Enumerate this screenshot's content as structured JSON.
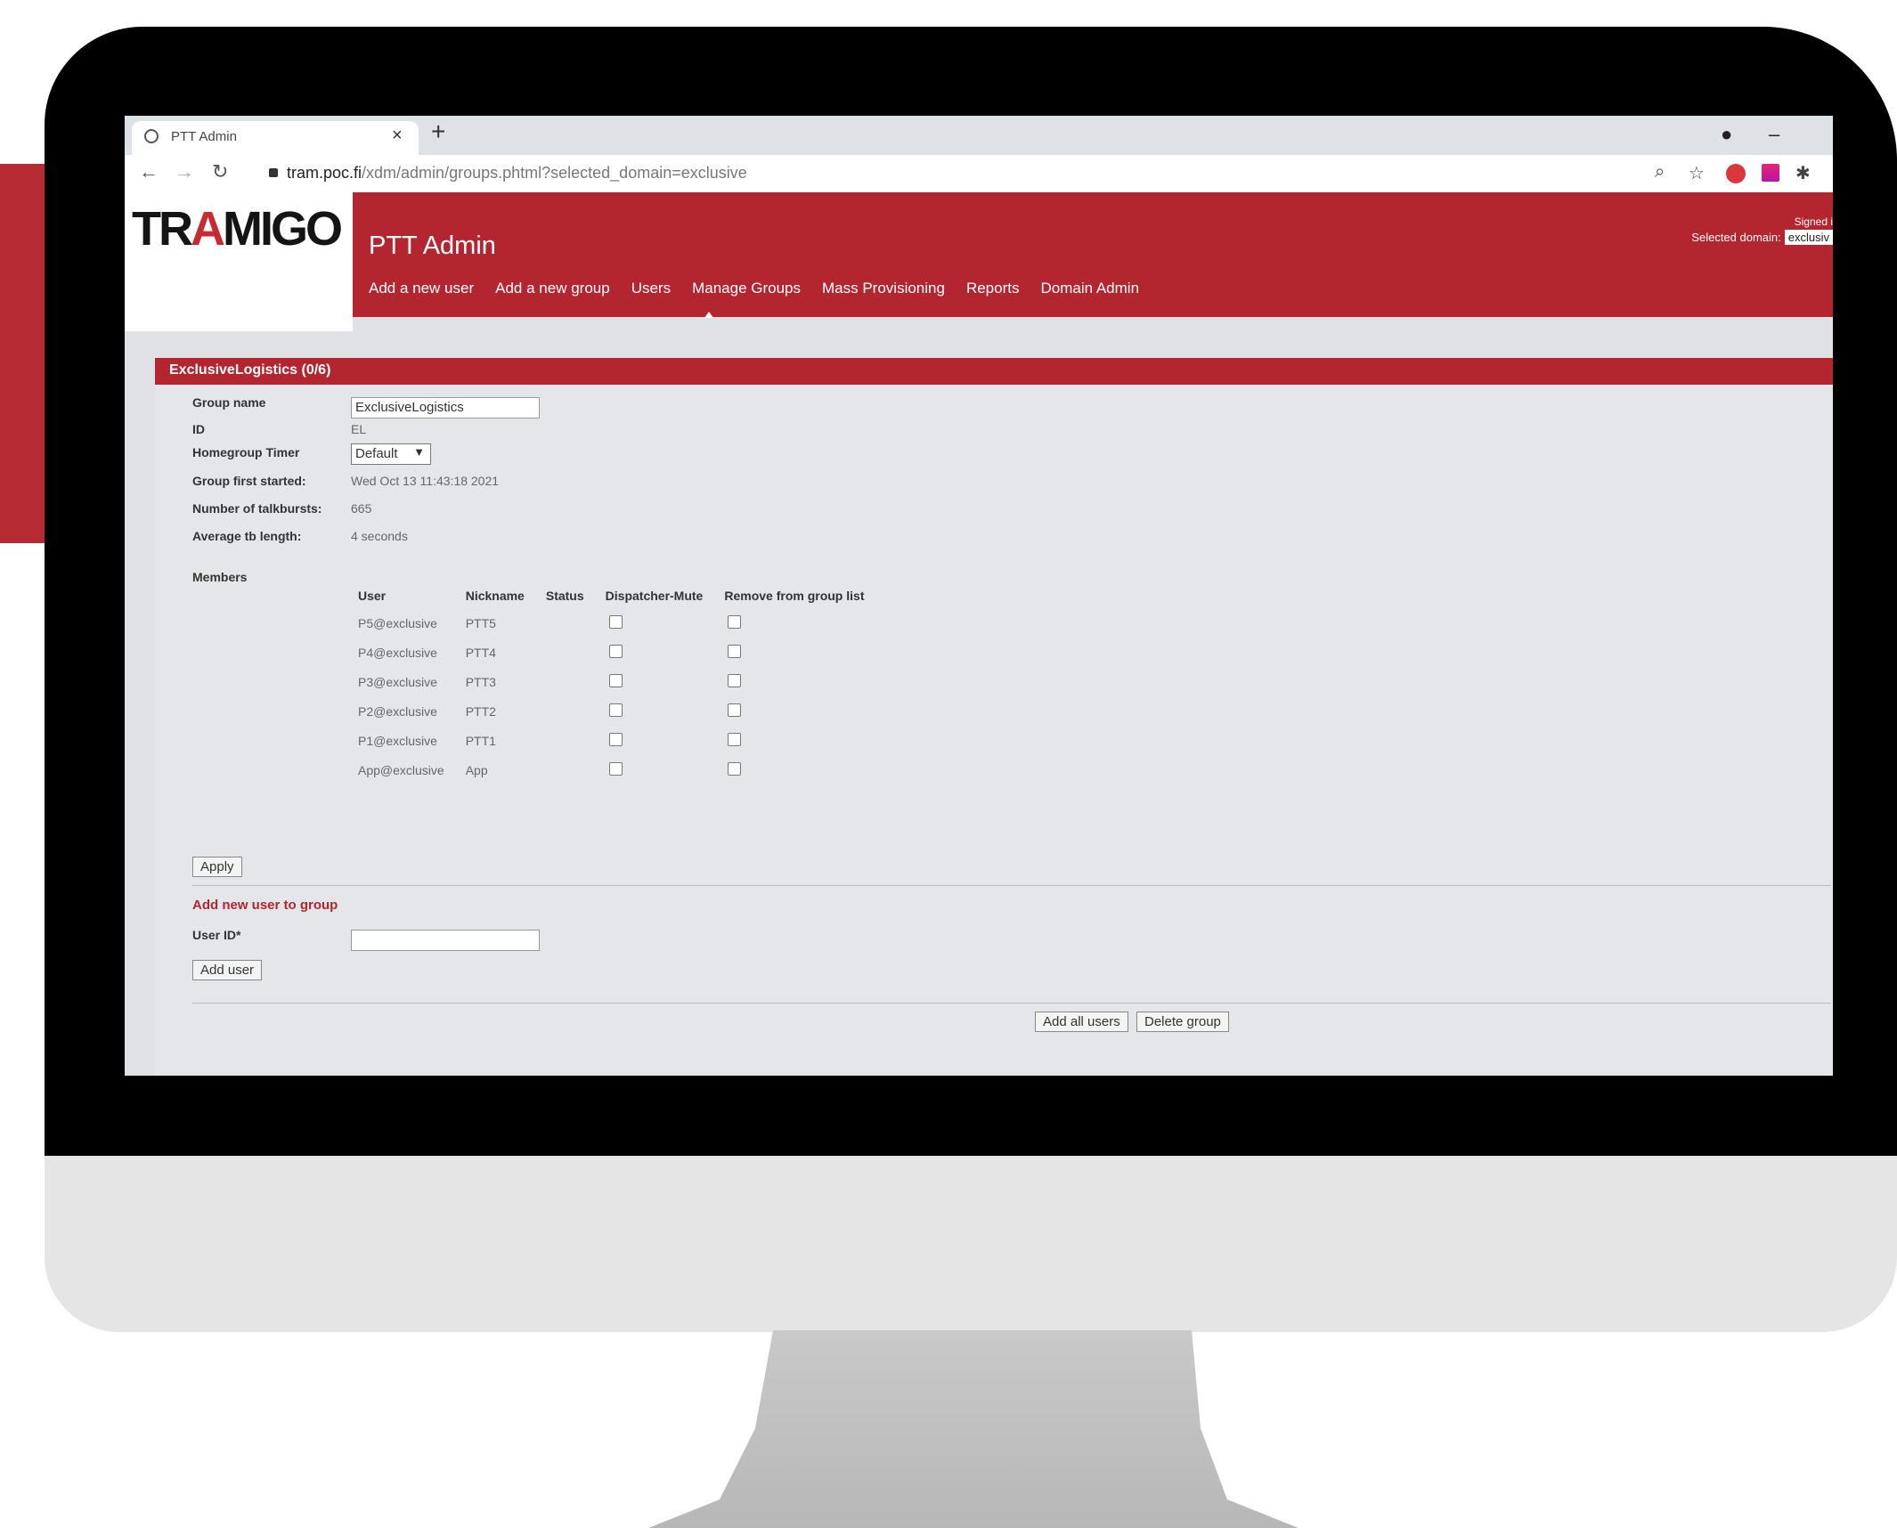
{
  "browser": {
    "tab_title": "PTT Admin",
    "tab_close": "×",
    "new_tab": "+",
    "url_host": "tram.poc.fi",
    "url_path": "/xdm/admin/groups.phtml?selected_domain=exclusive",
    "minimize": "–"
  },
  "brand": {
    "logo_pre": "TR",
    "logo_a": "A",
    "logo_post": "MIGO"
  },
  "header": {
    "title": "PTT Admin",
    "signed": "Signed i",
    "selected_domain_label": "Selected domain:",
    "selected_domain_value": "exclusiv"
  },
  "menu": [
    "Add a new user",
    "Add a new group",
    "Users",
    "Manage Groups",
    "Mass Provisioning",
    "Reports",
    "Domain Admin"
  ],
  "group": {
    "section_title": "ExclusiveLogistics (0/6)",
    "labels": {
      "name": "Group name",
      "id": "ID",
      "timer": "Homegroup Timer",
      "first_started": "Group first started:",
      "talkbursts": "Number of talkbursts:",
      "avg_tb": "Average tb length:",
      "members": "Members"
    },
    "name_value": "ExclusiveLogistics",
    "id_value": "EL",
    "timer_value": "Default",
    "first_started_value": "Wed Oct 13 11:43:18 2021",
    "talkbursts_value": "665",
    "avg_tb_value": "4 seconds"
  },
  "members": {
    "headers": [
      "User",
      "Nickname",
      "Status",
      "Dispatcher-Mute",
      "Remove from group list"
    ],
    "rows": [
      {
        "user": "P5@exclusive",
        "nickname": "PTT5",
        "status": ""
      },
      {
        "user": "P4@exclusive",
        "nickname": "PTT4",
        "status": ""
      },
      {
        "user": "P3@exclusive",
        "nickname": "PTT3",
        "status": ""
      },
      {
        "user": "P2@exclusive",
        "nickname": "PTT2",
        "status": ""
      },
      {
        "user": "P1@exclusive",
        "nickname": "PTT1",
        "status": ""
      },
      {
        "user": "App@exclusive",
        "nickname": "App",
        "status": ""
      }
    ]
  },
  "actions": {
    "apply": "Apply",
    "add_new_user_heading": "Add new user to group",
    "user_id_label": "User ID*",
    "user_id_value": "",
    "add_user": "Add user",
    "add_all_users": "Add all users",
    "delete_group": "Delete group"
  }
}
